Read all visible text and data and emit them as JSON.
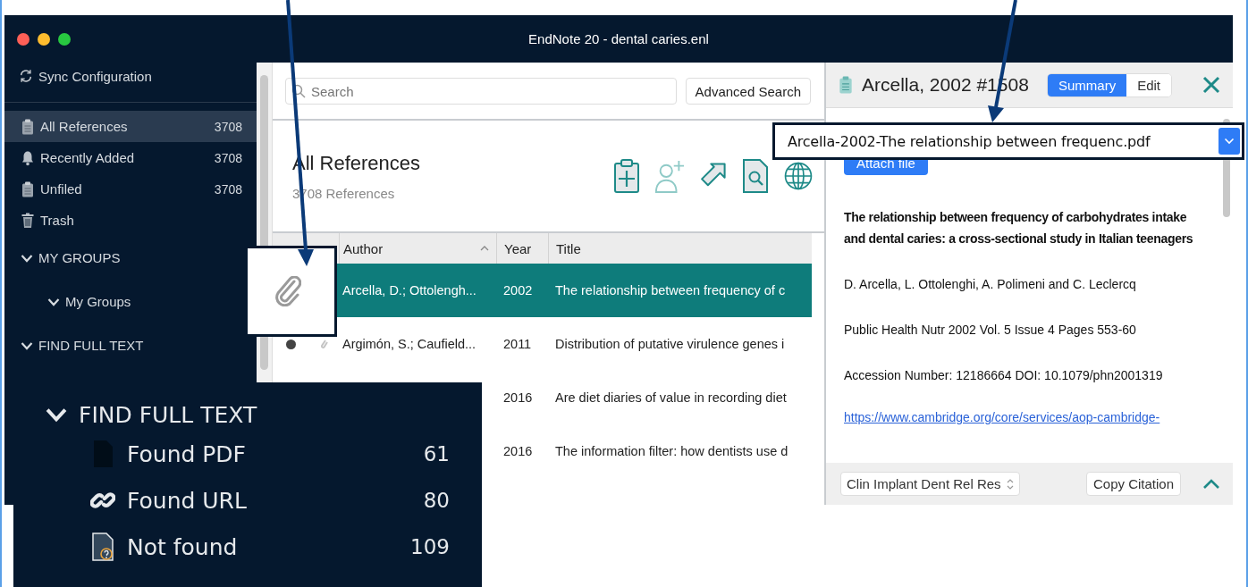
{
  "window": {
    "title": "EndNote 20 - dental caries.enl"
  },
  "sidebar": {
    "sync": "Sync Configuration",
    "items": [
      {
        "label": "All References",
        "count": "3708",
        "kind": "clipboard",
        "selected": true
      },
      {
        "label": "Recently Added",
        "count": "3708",
        "kind": "bell",
        "selected": false
      },
      {
        "label": "Unfiled",
        "count": "3708",
        "kind": "clipboard",
        "selected": false
      },
      {
        "label": "Trash",
        "kind": "trash",
        "selected": false
      }
    ],
    "groups": [
      {
        "label": "MY GROUPS",
        "expanded": true,
        "children": [
          {
            "label": "My Groups",
            "expanded": true
          }
        ]
      },
      {
        "label": "FIND FULL TEXT",
        "expanded": true
      }
    ]
  },
  "search": {
    "placeholder": "Search"
  },
  "advanced_search": "Advanced Search",
  "library": {
    "title": "All References",
    "count": "3708 References"
  },
  "table": {
    "columns": [
      "Author",
      "Year",
      "Title"
    ],
    "rows": [
      {
        "author": "Arcella, D.; Ottolengh...",
        "year": "2002",
        "title": "The relationship between frequency of c",
        "selected": true
      },
      {
        "author": "Argimón, S.; Caufield...",
        "year": "2011",
        "title": "Distribution of putative virulence genes i",
        "selected": false,
        "marker_icons": true
      },
      {
        "year": "2016",
        "title": "Are diet diaries of value in recording diet",
        "selected": false
      },
      {
        "year": "2016",
        "title": "The information filter: how dentists use d",
        "selected": false
      }
    ]
  },
  "reference": {
    "heading": "Arcella, 2002 #1508",
    "tabs": [
      {
        "label": "Summary",
        "selected": true
      },
      {
        "label": "Edit",
        "selected": false
      }
    ],
    "attach_button": "Attach file",
    "title": "The relationship between frequency of carbohydrates intake and dental caries: a cross-sectional study in Italian teenagers",
    "authors": "D. Arcella, L. Ottolenghi, A. Polimeni and C. Leclercq",
    "source": "Public Health Nutr 2002 Vol. 5 Issue 4 Pages 553-60",
    "ids": "Accession Number: 12186664 DOI: 10.1079/phn2001319",
    "link": "https://www.cambridge.org/core/services/aop-cambridge-",
    "style_select": "Clin Implant Dent Rel Res",
    "copy_button": "Copy Citation"
  },
  "callouts": {
    "file_select": {
      "value": "Arcella-2002-The relationship between frequenc.pdf"
    },
    "find_full_text": {
      "label": "FIND FULL TEXT",
      "expanded": true,
      "items": [
        {
          "label": "Found PDF",
          "count": "61",
          "kind": "pdf"
        },
        {
          "label": "Found URL",
          "count": "80",
          "kind": "url"
        },
        {
          "label": "Not found",
          "count": "109",
          "kind": "missing"
        }
      ]
    }
  }
}
